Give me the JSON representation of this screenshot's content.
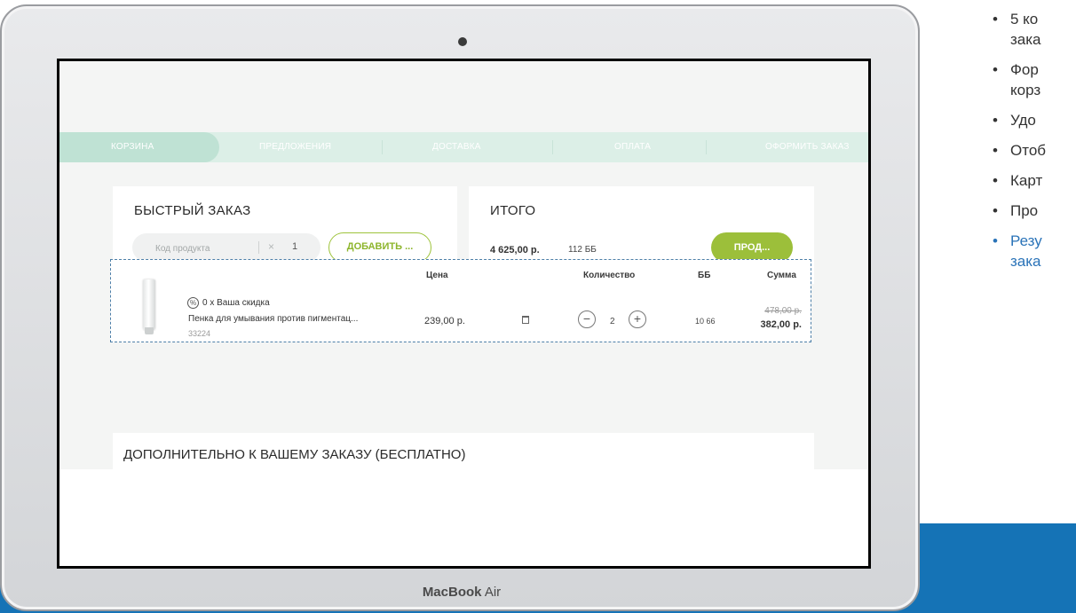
{
  "slide": {
    "bullets": [
      {
        "text": "5 ко\nзака",
        "highlight": false
      },
      {
        "text": "Фор\nкорз",
        "highlight": false
      },
      {
        "text": "Удо",
        "highlight": false
      },
      {
        "text": "Отоб",
        "highlight": false
      },
      {
        "text": "Карт",
        "highlight": false
      },
      {
        "text": "Про",
        "highlight": false
      },
      {
        "text": "Резу\nзака",
        "highlight": true
      }
    ],
    "band_color": "#1573b6"
  },
  "laptop": {
    "brand_bold": "MacBook",
    "brand_light": " Air"
  },
  "steps": [
    {
      "label": "КОРЗИНА",
      "active": true
    },
    {
      "label": "ПРЕДЛОЖЕНИЯ",
      "active": false
    },
    {
      "label": "ДОСТАВКА",
      "active": false
    },
    {
      "label": "ОПЛАТА",
      "active": false
    },
    {
      "label": "ОФОРМИТЬ ЗАКАЗ",
      "active": false
    }
  ],
  "quick_order": {
    "title": "БЫСТРЫЙ ЗАКАЗ",
    "code_placeholder": "Код продукта",
    "times": "×",
    "qty": "1",
    "add_button": "ДОБАВИТЬ ..."
  },
  "total": {
    "title": "ИТОГО",
    "amount": "4 625,00 р.",
    "bb": "112 ББ",
    "checkout_button": "ПРОД..."
  },
  "cart": {
    "headers": {
      "price": "Цена",
      "quantity": "Количество",
      "bb": "ББ",
      "sum": "Сумма"
    },
    "items": [
      {
        "discount": "0 х Ваша скидка",
        "name": "Пенка для умывания против пигментац...",
        "code": "33224",
        "price": "239,00 р.",
        "minus": "−",
        "qty": "2",
        "plus": "+",
        "bb": "10 66",
        "old_sum": "478,00 р.",
        "sum": "382,00 р."
      }
    ]
  },
  "extra": {
    "title": "ДОПОЛНИТЕЛЬНО К ВАШЕМУ ЗАКАЗУ (БЕСПЛАТНО)"
  },
  "colors": {
    "accent_green": "#9cbf3a",
    "tab_mint": "#dcefe7",
    "cart_border": "#4d7fa8"
  }
}
